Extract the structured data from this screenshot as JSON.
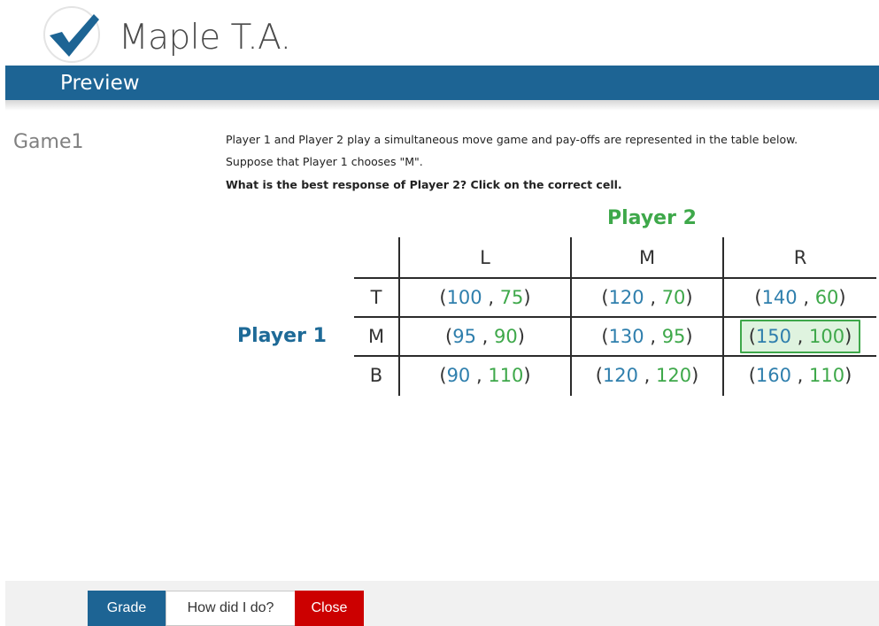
{
  "app": {
    "name": "Maple T.A."
  },
  "header": {
    "title": "Preview"
  },
  "question": {
    "name": "Game1",
    "line1": "Player 1 and Player 2 play a simultaneous move game and pay-offs are represented in the table below.",
    "line2": "Suppose that Player 1 chooses \"M\".",
    "line3": "What is the best response of Player 2? Click on the correct cell."
  },
  "game_table": {
    "player2_label": "Player 2",
    "player1_label": "Player 1",
    "columns": [
      "L",
      "M",
      "R"
    ],
    "rows": [
      {
        "label": "T",
        "cells": [
          {
            "p1": "100",
            "p2": "75"
          },
          {
            "p1": "120",
            "p2": "70"
          },
          {
            "p1": "140",
            "p2": "60"
          }
        ]
      },
      {
        "label": "M",
        "cells": [
          {
            "p1": "95",
            "p2": "90"
          },
          {
            "p1": "130",
            "p2": "95"
          },
          {
            "p1": "150",
            "p2": "100"
          }
        ]
      },
      {
        "label": "B",
        "cells": [
          {
            "p1": "90",
            "p2": "110"
          },
          {
            "p1": "120",
            "p2": "120"
          },
          {
            "p1": "160",
            "p2": "110"
          }
        ]
      }
    ],
    "selected_cell": "M-R"
  },
  "toolbar": {
    "grade_label": "Grade",
    "how_label": "How did I do?",
    "close_label": "Close"
  },
  "colors": {
    "brand_blue": "#1d6494",
    "player1_blue": "#2f7fad",
    "player2_green": "#3ea84a",
    "close_red": "#cc0000"
  }
}
